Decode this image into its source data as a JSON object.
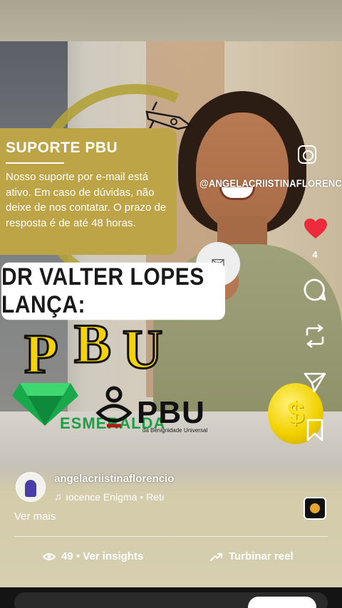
{
  "overlay": {
    "support_title": "SUPORTE PBU",
    "support_body": "Nosso suporte por e-mail está ativo. Em caso de dúvidas, não deixe de nos contatar. O prazo de resposta é de até 48 horas.",
    "headline": "DR VALTER LOPES LANÇA:",
    "pbu_big_letters": [
      "P",
      "B",
      "U"
    ],
    "esmeralda_label": "ESMERALDA",
    "pbu_logo_text": "PBU",
    "pbu_logo_sub": "da Benignidade Universal",
    "coin_symbol": "$"
  },
  "rail": {
    "handle": "@ANGELACRIISTINAFLORENCIO",
    "like_count": "4",
    "icons": [
      "instagram-icon",
      "heart-icon",
      "comment-icon",
      "repost-icon",
      "share-icon",
      "bookmark-icon"
    ]
  },
  "post": {
    "username": "angelacriistinaflorencio",
    "audio_text": "ıocence    Enigma • Retı",
    "more_label": "Ver mais",
    "insights_label": "49 • Ver insights",
    "boost_label": "Turbinar reel"
  },
  "colors": {
    "card_gold": "#bda446",
    "pbu_yellow": "#f5d20b",
    "like_red": "#ed2b3c",
    "emerald_green": "#1e9e45"
  }
}
